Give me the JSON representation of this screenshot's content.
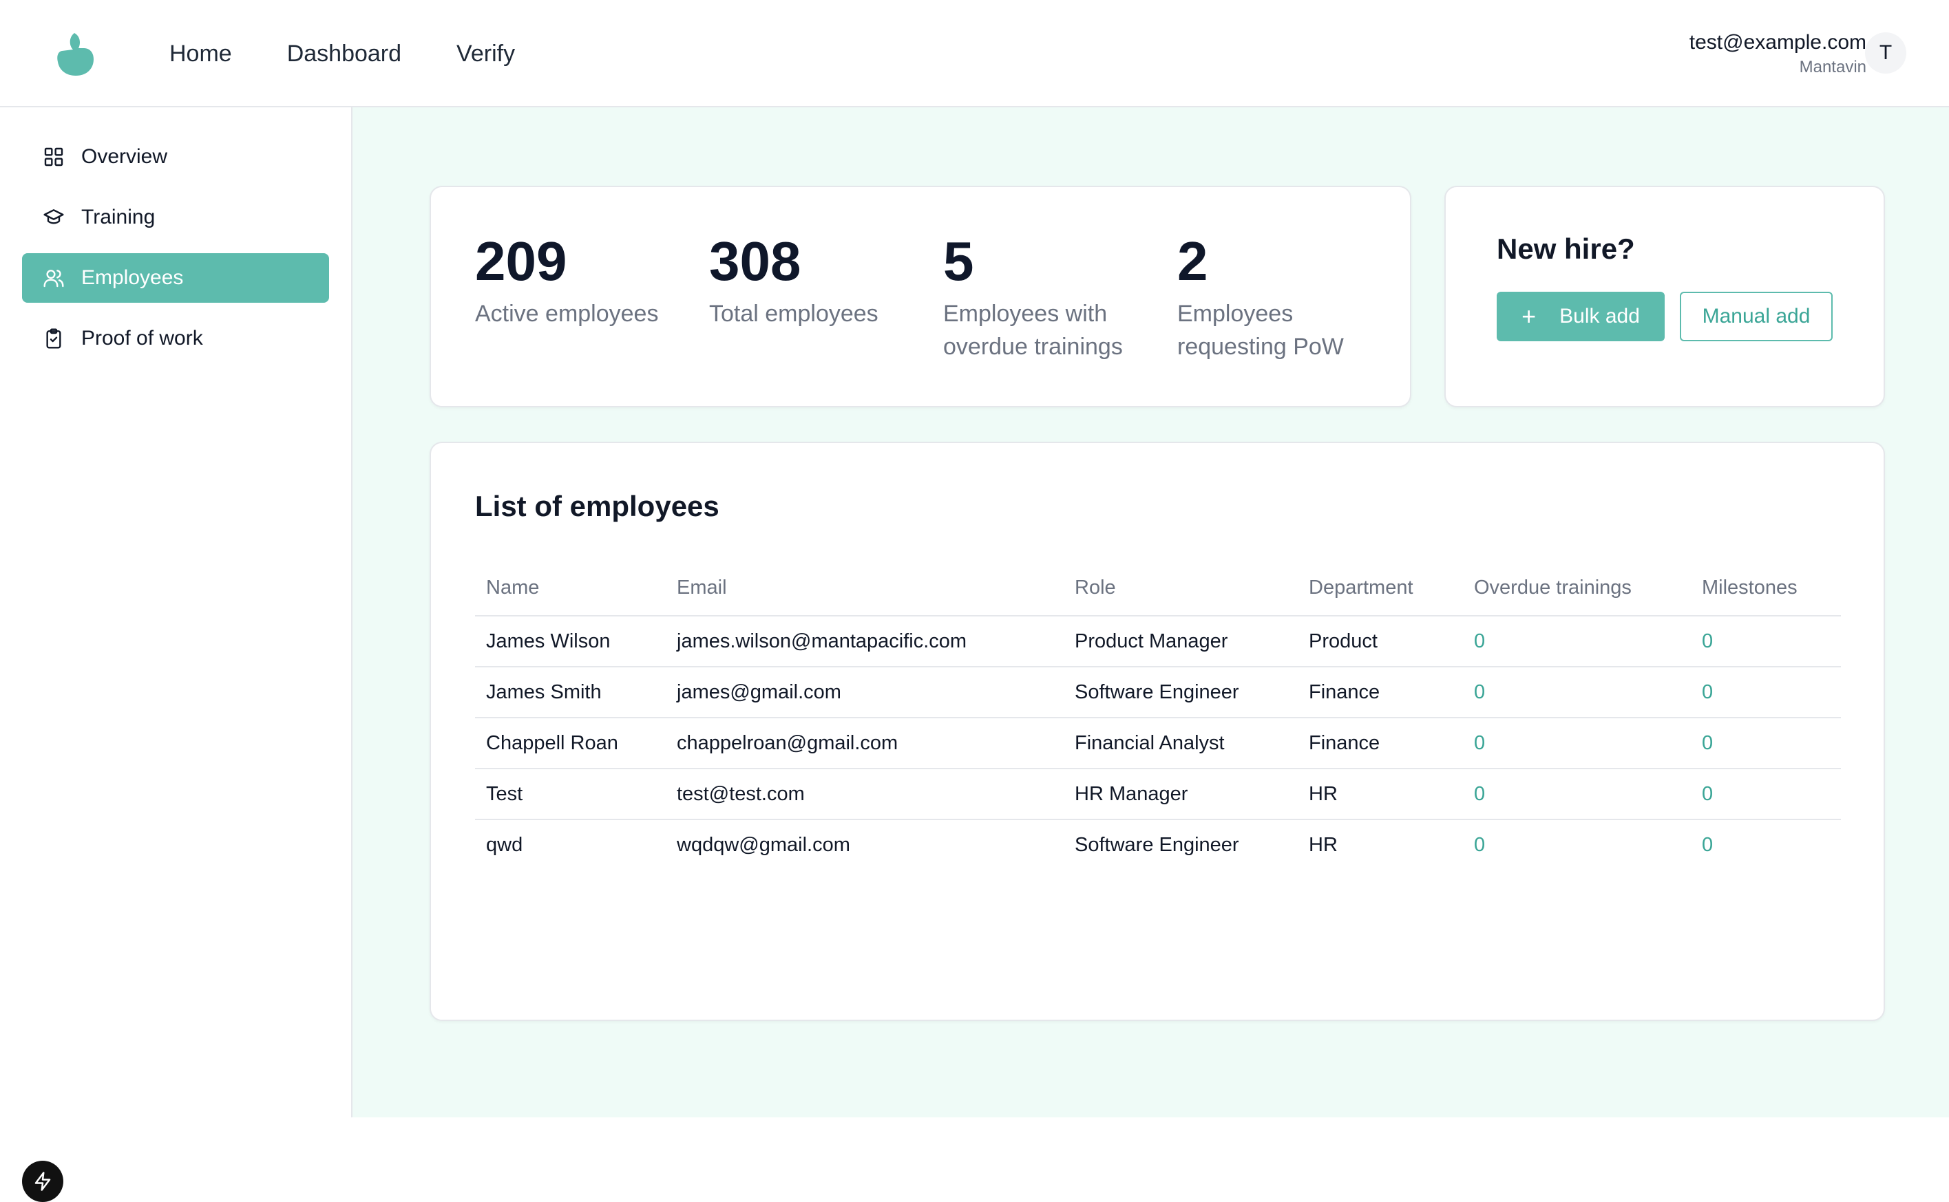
{
  "header": {
    "nav": [
      "Home",
      "Dashboard",
      "Verify"
    ],
    "user_email": "test@example.com",
    "user_org": "Mantavin",
    "avatar_initial": "T"
  },
  "sidebar": {
    "items": [
      {
        "label": "Overview",
        "icon": "grid-icon"
      },
      {
        "label": "Training",
        "icon": "graduation-cap-icon"
      },
      {
        "label": "Employees",
        "icon": "users-icon",
        "active": true
      },
      {
        "label": "Proof of work",
        "icon": "clipboard-check-icon"
      }
    ]
  },
  "stats": [
    {
      "value": "209",
      "label": "Active employees"
    },
    {
      "value": "308",
      "label": "Total employees"
    },
    {
      "value": "5",
      "label": "Employees with overdue trainings"
    },
    {
      "value": "2",
      "label": "Employees requesting PoW"
    }
  ],
  "new_hire": {
    "title": "New hire?",
    "bulk_add": "Bulk add",
    "manual_add": "Manual add"
  },
  "employees": {
    "title": "List of employees",
    "columns": [
      "Name",
      "Email",
      "Role",
      "Department",
      "Overdue trainings",
      "Milestones"
    ],
    "rows": [
      [
        "James Wilson",
        "james.wilson@mantapacific.com",
        "Product Manager",
        "Product",
        "0",
        "0"
      ],
      [
        "James Smith",
        "james@gmail.com",
        "Software Engineer",
        "Finance",
        "0",
        "0"
      ],
      [
        "Chappell Roan",
        "chappelroan@gmail.com",
        "Financial Analyst",
        "Finance",
        "0",
        "0"
      ],
      [
        "Test",
        "test@test.com",
        "HR Manager",
        "HR",
        "0",
        "0"
      ],
      [
        "qwd",
        "wqdqw@gmail.com",
        "Software Engineer",
        "HR",
        "0",
        "0"
      ]
    ]
  },
  "colors": {
    "accent": "#5dbbad",
    "accent_text": "#3aa596",
    "main_bg": "#effbf7"
  }
}
